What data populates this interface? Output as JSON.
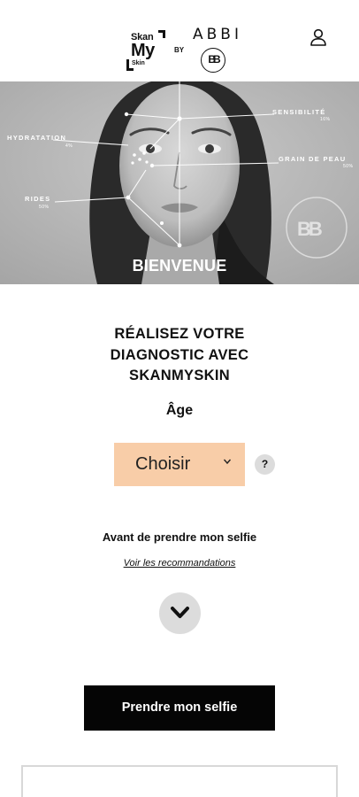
{
  "header": {
    "logo_line1": "Skan",
    "logo_line2": "My",
    "logo_line3": "Skin",
    "by": "BY",
    "partner": "ABBI",
    "partner_badge": "BB",
    "user_icon": "user-icon"
  },
  "hero": {
    "labels": {
      "hydratation": "HYDRATATION",
      "sensibilite": "SENSIBILITÉ",
      "grain": "GRAIN DE PEAU",
      "rides": "RIDES"
    },
    "subs": {
      "hydratation": "4%",
      "sensibilite": "16%",
      "grain": "50%",
      "rides": "50%"
    },
    "watermark": "BB",
    "welcome": "BIENVENUE"
  },
  "main": {
    "title_line1": "RÉALISEZ VOTRE",
    "title_line2": "DIAGNOSTIC AVEC",
    "title_line3": "SKANMYSKIN",
    "age_label": "Âge",
    "age_select_value": "Choisir",
    "help": "?",
    "before_selfie": "Avant de prendre mon selfie",
    "recommendations_link": "Voir les recommandations",
    "cta": "Prendre mon selfie"
  },
  "colors": {
    "select_bg": "#f8cda8",
    "cta_bg": "#050505",
    "round_btn_bg": "#dcdcdc"
  }
}
